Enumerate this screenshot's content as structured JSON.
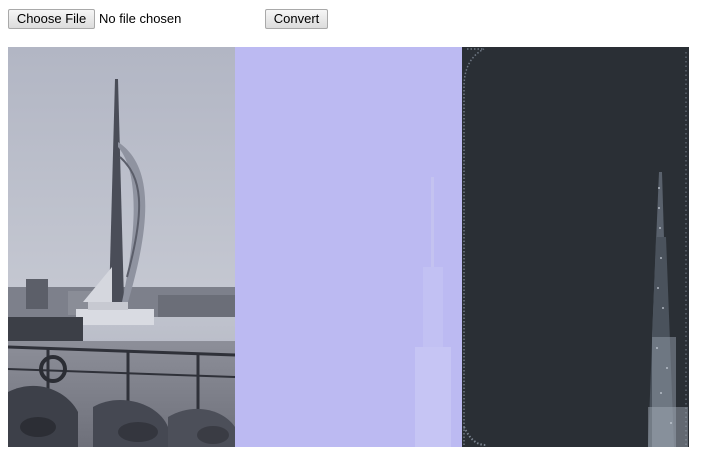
{
  "toolbar": {
    "choose_file_label": "Choose File",
    "file_status": "No file chosen",
    "convert_label": "Convert"
  },
  "panels": [
    {
      "name": "source-photo",
      "content": "photo of Spinnaker Tower from a ferry deck",
      "background": "#b6bac6"
    },
    {
      "name": "light-render",
      "content": "light lavender ascii render",
      "background": "#bcbaf2"
    },
    {
      "name": "dark-render",
      "content": "dark ascii render",
      "background": "#2a2f35"
    }
  ]
}
